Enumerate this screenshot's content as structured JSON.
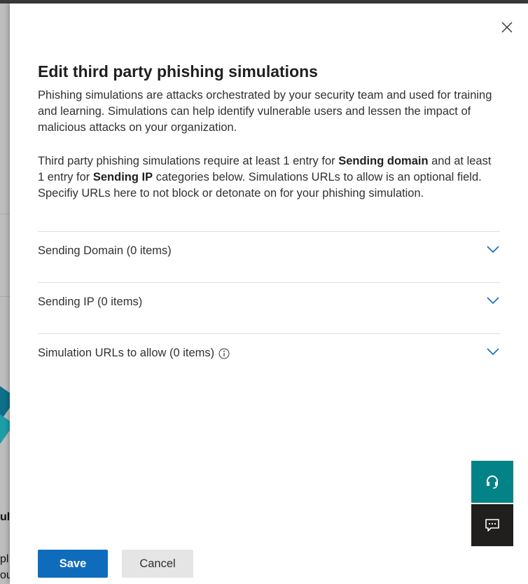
{
  "panel": {
    "title": "Edit third party phishing simulations",
    "intro": "Phishing simulations are attacks orchestrated by your security team and used for training and learning. Simulations can help identify vulnerable users and lessen the impact of malicious attacks on your organization.",
    "req_part1": "Third party phishing simulations require at least 1 entry for ",
    "req_bold1": "Sending domain",
    "req_part2": " and at least 1 entry for ",
    "req_bold2": "Sending IP",
    "req_part3": " categories below. Simulations URLs to allow is an optional field. Specifiy URLs here to not block or detonate on for your phishing simulation."
  },
  "sections": [
    {
      "label": "Sending Domain (0 items)",
      "expanded": false
    },
    {
      "label": "Sending IP (0 items)",
      "expanded": false
    },
    {
      "label": "Simulation URLs to allow (0 items)",
      "expanded": false,
      "icon": "info-icon"
    }
  ],
  "footer": {
    "save_label": "Save",
    "cancel_label": "Cancel"
  },
  "backdrop": {
    "text_fragment_1": "ula",
    "text_fragment_2": "pl",
    "text_fragment_3": "ou"
  },
  "icons": {
    "close": "close-icon",
    "chevron": "chevron-down-icon",
    "help": "headset-icon",
    "feedback": "chat-icon"
  },
  "colors": {
    "accent": "#0f6cbd",
    "help_fab": "#038387",
    "feedback_fab": "#201f1e",
    "divider": "#e1dfdd"
  }
}
